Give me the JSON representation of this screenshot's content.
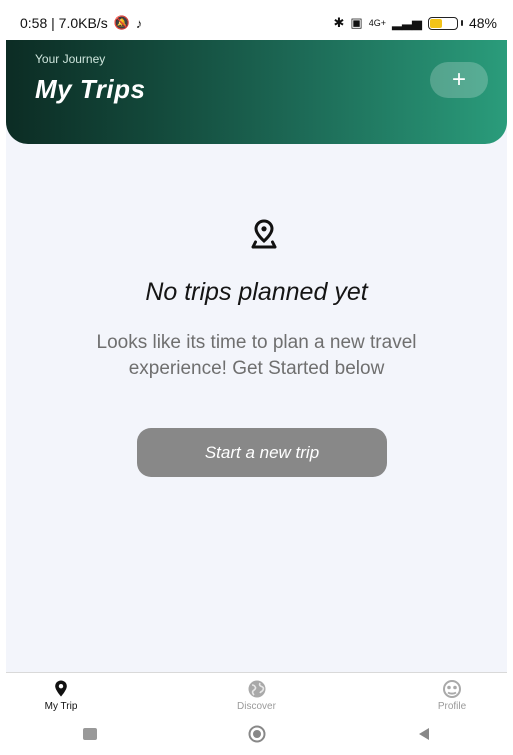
{
  "status_bar": {
    "time_speed": "0:58 | 7.0KB/s",
    "network_label": "4G+",
    "battery_percent": "48%",
    "battery_level": 0.48
  },
  "header": {
    "subtitle": "Your Journey",
    "title": "My Trips",
    "add_button_label": "+"
  },
  "empty_state": {
    "title": "No trips planned yet",
    "description": "Looks like its time to plan a new travel experience! Get Started below",
    "button_label": "Start a new trip"
  },
  "bottom_nav": {
    "items": [
      {
        "label": "My Trip",
        "icon": "location-pin-icon",
        "active": true
      },
      {
        "label": "Discover",
        "icon": "globe-icon",
        "active": false
      },
      {
        "label": "Profile",
        "icon": "profile-icon",
        "active": false
      }
    ]
  },
  "colors": {
    "header_gradient_start": "#0c2c24",
    "header_gradient_end": "#2a9c7b",
    "button_gray": "#888888",
    "background": "#f3f5fb"
  }
}
